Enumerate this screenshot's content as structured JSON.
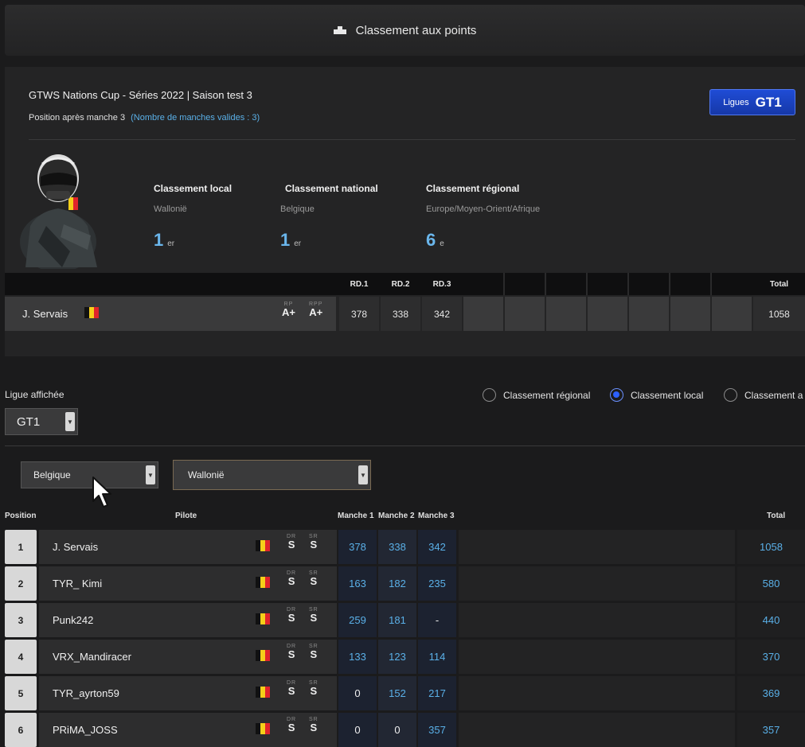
{
  "header": {
    "title": "Classement aux points",
    "icon": "podium-icon"
  },
  "event": {
    "title": "GTWS Nations Cup - Séries 2022 | Saison test 3",
    "position_after": "Position après manche 3",
    "valid_rounds": "(Nombre de manches valides : 3)",
    "ligues_label": "Ligues",
    "ligues_value": "GT1"
  },
  "ranks": [
    {
      "heading": "Classement local",
      "scope": "Wallonië",
      "value": "1",
      "suffix": "er"
    },
    {
      "heading": "Classement national",
      "scope": "Belgique",
      "value": "1",
      "suffix": "er"
    },
    {
      "heading": "Classement régional",
      "scope": "Europe/Moyen-Orient/Afrique",
      "value": "6",
      "suffix": "e"
    }
  ],
  "summary": {
    "headers": {
      "rd1": "RD.1",
      "rd2": "RD.2",
      "rd3": "RD.3",
      "total": "Total"
    },
    "driver": "J. Servais",
    "rr_label": "RP",
    "rr_value": "A+",
    "rrp_label": "RPP",
    "rrp_value": "A+",
    "rd1": "378",
    "rd2": "338",
    "rd3": "342",
    "total": "1058"
  },
  "filters": {
    "ligue_label": "Ligue affichée",
    "ligue_value": "GT1",
    "country_value": "Belgique",
    "region_value": "Wallonië",
    "radio_regional": "Classement régional",
    "radio_local": "Classement local",
    "radio_other": "Classement a"
  },
  "table": {
    "headers": {
      "position": "Position",
      "pilote": "Pilote",
      "m1": "Manche 1",
      "m2": "Manche 2",
      "m3": "Manche 3",
      "total": "Total"
    },
    "dr_label": "DR",
    "sr_label": "SR",
    "rows": [
      {
        "pos": "1",
        "name": "J. Servais",
        "dr": "S",
        "sr": "S",
        "m1": "378",
        "m2": "338",
        "m3": "342",
        "total": "1058"
      },
      {
        "pos": "2",
        "name": "TYR_ Kimi",
        "dr": "S",
        "sr": "S",
        "m1": "163",
        "m2": "182",
        "m3": "235",
        "total": "580"
      },
      {
        "pos": "3",
        "name": "Punk242",
        "dr": "S",
        "sr": "S",
        "m1": "259",
        "m2": "181",
        "m3": "-",
        "total": "440"
      },
      {
        "pos": "4",
        "name": "VRX_Mandiracer",
        "dr": "S",
        "sr": "S",
        "m1": "133",
        "m2": "123",
        "m3": "114",
        "total": "370"
      },
      {
        "pos": "5",
        "name": "TYR_ayrton59",
        "dr": "S",
        "sr": "S",
        "m1": "0",
        "m2": "152",
        "m3": "217",
        "total": "369"
      },
      {
        "pos": "6",
        "name": "PRiMA_JOSS",
        "dr": "S",
        "sr": "S",
        "m1": "0",
        "m2": "0",
        "m3": "357",
        "total": "357"
      }
    ]
  },
  "colors": {
    "accent_blue": "#5ab0e8",
    "ligue_button": "#1f4cd6",
    "radio_selected": "#2c60ff"
  }
}
